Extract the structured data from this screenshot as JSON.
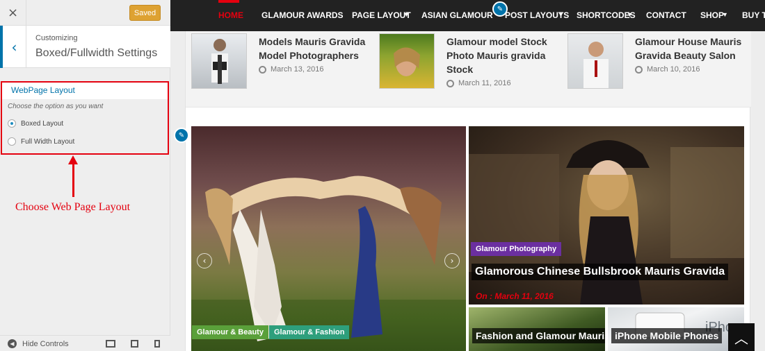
{
  "customizer": {
    "close_icon": "×",
    "saved_label": "Saved",
    "back_icon": "‹",
    "customizing_label": "Customizing",
    "section_title": "Boxed/Fullwidth Settings",
    "option": {
      "title": "WebPage Layout",
      "description": "Choose the option as you want",
      "choices": [
        {
          "label": "Boxed Layout",
          "selected": true
        },
        {
          "label": "Full Width Layout",
          "selected": false
        }
      ]
    },
    "annotation": "Choose Web Page Layout",
    "footer": {
      "hide_controls": "Hide Controls",
      "hide_icon": "◀"
    }
  },
  "nav": {
    "items": [
      "HOME",
      "GLAMOUR AWARDS",
      "PAGE LAYOUT",
      "ASIAN GLAMOUR",
      "POST LAYOUTS",
      "SHORTCODES",
      "CONTACT",
      "SHOP",
      "BUY TH"
    ],
    "active": "HOME"
  },
  "recent_posts": [
    {
      "title": "Models Mauris Gravida Model Photographers",
      "date": "March 13, 2016"
    },
    {
      "title": "Glamour model Stock Photo Mauris gravida Stock",
      "date": "March 11, 2016"
    },
    {
      "title": "Glamour House Mauris Gravida Beauty Salon",
      "date": "March 10, 2016"
    }
  ],
  "slider": {
    "prev_icon": "‹",
    "next_icon": "›",
    "tags": [
      "Glamour & Beauty",
      "Glamour & Fashion"
    ]
  },
  "featured": {
    "category": "Glamour Photography",
    "title": "Glamorous Chinese Bullsbrook Mauris Gravida",
    "date": "On : March 11, 2016"
  },
  "small_posts": [
    {
      "title": "Fashion and Glamour Mauris gravida"
    },
    {
      "title": "iPhone Mobile Phones"
    }
  ],
  "scroll_top_icon": "︿",
  "colors": {
    "accent_red": "#e4000f",
    "wp_blue": "#0073aa",
    "saved_orange": "#dea232",
    "tag_green": "#5aa03a",
    "tag_teal": "#2e9f7c",
    "tag_purple": "#6b2fa0"
  }
}
